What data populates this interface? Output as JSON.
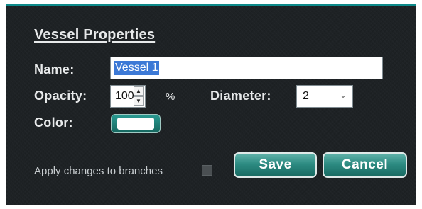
{
  "dialog": {
    "title": "Vessel Properties",
    "name_label": "Name:",
    "name_value": "Vessel 1",
    "opacity_label": "Opacity:",
    "opacity_value": "100",
    "opacity_unit": "%",
    "diameter_label": "Diameter:",
    "diameter_value": "2",
    "color_label": "Color:",
    "color_value": "#ffffff",
    "apply_label": "Apply changes to branches",
    "apply_checked": false,
    "save_label": "Save",
    "cancel_label": "Cancel"
  },
  "icons": {
    "spin_up": "spin-up-arrow",
    "spin_down": "spin-down-arrow",
    "dropdown": "chevron-down"
  },
  "colors": {
    "accent": "#2d8b82",
    "background": "#1e2225",
    "selection": "#3c79d6"
  }
}
